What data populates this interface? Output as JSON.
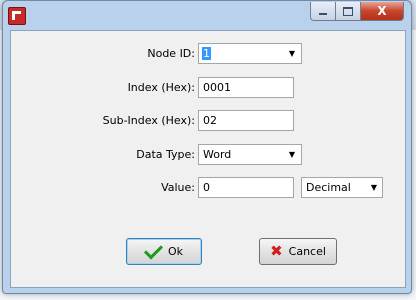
{
  "window": {
    "close_glyph": "X",
    "minimize_glyph": "_",
    "maximize_glyph": "□"
  },
  "form": {
    "node_id": {
      "label": "Node ID:",
      "value": "1"
    },
    "index": {
      "label": "Index (Hex):",
      "value": "0001"
    },
    "subindex": {
      "label": "Sub-Index (Hex):",
      "value": "02"
    },
    "datatype": {
      "label": "Data Type:",
      "value": "Word"
    },
    "value": {
      "label": "Value:",
      "value": "0",
      "format": "Decimal"
    }
  },
  "buttons": {
    "ok": "Ok",
    "cancel": "Cancel"
  },
  "icons": {
    "app": "app-icon",
    "ok": "checkmark-icon",
    "cancel": "x-icon",
    "dropdown": "dropdown-arrow-icon"
  },
  "colors": {
    "frame": "#b9d1ea",
    "client": "#f0f0f0",
    "close_button": "#c7452b",
    "checkmark": "#1c9a1c",
    "x_mark": "#d11f1f",
    "selection": "#3399ff"
  }
}
